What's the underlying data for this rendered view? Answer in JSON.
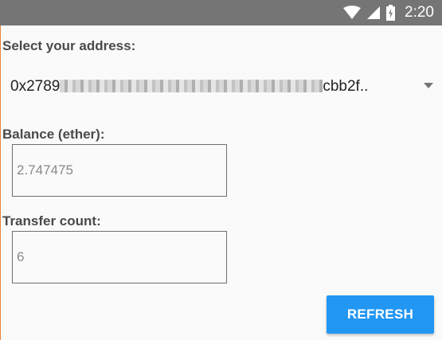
{
  "status_bar": {
    "time": "2:20",
    "icons": [
      "wifi-icon",
      "cell-signal-icon",
      "battery-charging-icon"
    ]
  },
  "address": {
    "label": "Select your address:",
    "value_prefix": "0x2789",
    "value_suffix": "cbb2f.."
  },
  "balance": {
    "label": "Balance (ether):",
    "value": "2.747475"
  },
  "transfer": {
    "label": "Transfer count:",
    "value": "6"
  },
  "actions": {
    "refresh_label": "REFRESH"
  },
  "colors": {
    "accent": "#2196f3",
    "status_bar": "#757575",
    "background": "#fafafa"
  }
}
